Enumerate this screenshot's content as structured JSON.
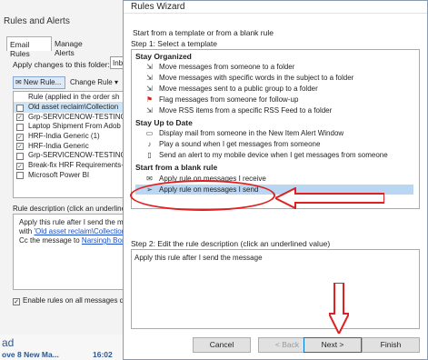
{
  "rules_alerts": {
    "title": "Rules and Alerts",
    "tabs": [
      "Email Rules",
      "Manage Alerts"
    ],
    "apply_label": "Apply changes to this folder:",
    "folder_value": "Inb",
    "new_rule": "New Rule...",
    "change_rule": "Change Rule",
    "list_header": "Rule (applied in the order sh",
    "rules": [
      {
        "name": "Old asset reclaim\\Collection",
        "checked": false,
        "selected": true
      },
      {
        "name": "Grp-SERVICENOW-TESTING",
        "checked": true,
        "selected": false
      },
      {
        "name": "Laptop Shipment From Adob",
        "checked": false,
        "selected": false
      },
      {
        "name": "HRF-India Generic (1)",
        "checked": true,
        "selected": false
      },
      {
        "name": "HRF-India Generic",
        "checked": true,
        "selected": false
      },
      {
        "name": "Grp-SERVICENOW-TESTING",
        "checked": false,
        "selected": false
      },
      {
        "name": "Break-fix HRF Requirements-",
        "checked": true,
        "selected": false
      },
      {
        "name": "Microsoft Power BI",
        "checked": false,
        "selected": false
      }
    ],
    "desc_label": "Rule description (click an underlined",
    "desc_line1": "Apply this rule after I send the m",
    "desc_with": "with ",
    "desc_link1": "'Old asset reclaim\\Collection",
    "desc_cc": "Cc the message to ",
    "desc_link2": "Narsingh Bon",
    "enable_label": "Enable rules on all messages do",
    "check_mark": "✓"
  },
  "background_outlook": {
    "ad_text": "ad",
    "move_text": "ove 8 New Ma...",
    "time": "16:02"
  },
  "wizard": {
    "title": "Rules Wizard",
    "start_text": "Start from a template or from a blank rule",
    "step1": "Step 1: Select a template",
    "groups": {
      "organized": "Stay Organized",
      "uptodate": "Stay Up to Date",
      "blank": "Start from a blank rule"
    },
    "templates": {
      "t1": "Move messages from someone to a folder",
      "t2": "Move messages with specific words in the subject to a folder",
      "t3": "Move messages sent to a public group to a folder",
      "t4": "Flag messages from someone for follow-up",
      "t5": "Move RSS items from a specific RSS Feed to a folder",
      "t6": "Display mail from someone in the New Item Alert Window",
      "t7": "Play a sound when I get messages from someone",
      "t8": "Send an alert to my mobile device when I get messages from someone",
      "t9": "Apply rule on messages I receive",
      "t10": "Apply rule on messages I send"
    },
    "step2": "Step 2: Edit the rule description (click an underlined value)",
    "description": "Apply this rule after I send the message",
    "buttons": {
      "cancel": "Cancel",
      "back": "< Back",
      "next": "Next >",
      "finish": "Finish"
    }
  },
  "colors": {
    "annotation": "#e02020",
    "selection": "#b9d7f2"
  }
}
